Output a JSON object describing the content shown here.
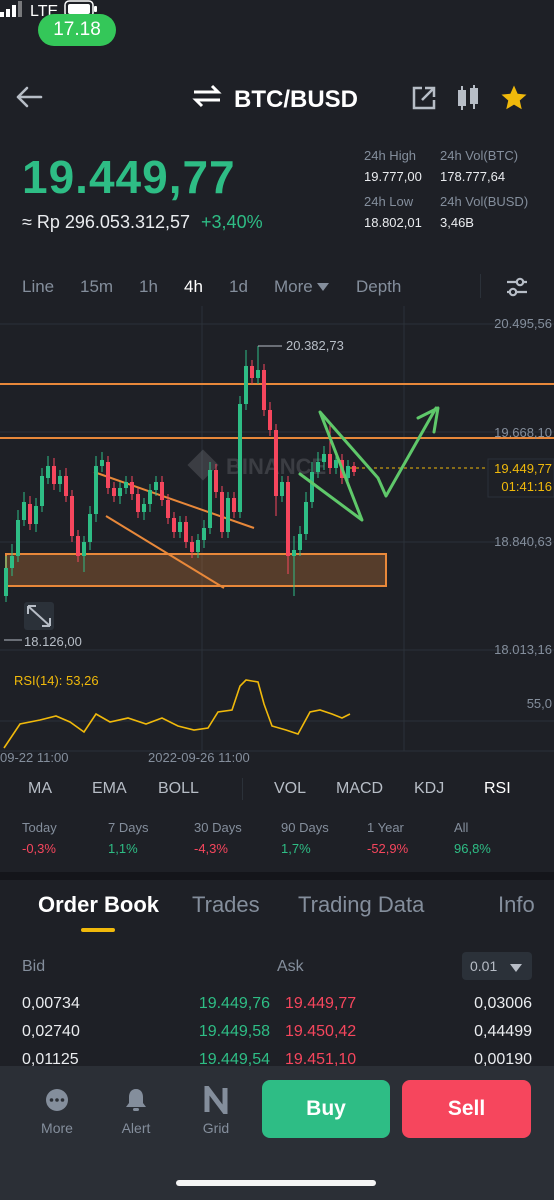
{
  "status_bar": {
    "time": "17.18",
    "network": "LTE"
  },
  "header": {
    "pair": "BTC/BUSD"
  },
  "price": {
    "last": "19.449,77",
    "idr": "≈ Rp 296.053.312,57",
    "change": "+3,40%"
  },
  "stats": {
    "high_label": "24h High",
    "high": "19.777,00",
    "vol_btc_label": "24h Vol(BTC)",
    "vol_btc": "178.777,64",
    "low_label": "24h Low",
    "low": "18.802,01",
    "vol_busd_label": "24h Vol(BUSD)",
    "vol_busd": "3,46B"
  },
  "timeframes": [
    "Line",
    "15m",
    "1h",
    "4h",
    "1d",
    "More",
    "Depth"
  ],
  "active_timeframe": "4h",
  "chart": {
    "watermark": "BINANCE",
    "y_axis_labels": [
      "20.495,56",
      "19.668,10",
      "18.840,63",
      "18.013,16"
    ],
    "current_price_tag": "19.449,77",
    "countdown_tag": "01:41:16",
    "high_marker": "20.382,73",
    "low_marker": "18.126,00",
    "x_labels": [
      "09-22 11:00",
      "2022-09-26 11:00"
    ],
    "rsi_label": "RSI(14): 53,26",
    "rsi_axis": "55,0",
    "candle_up_color": "#2ebd85",
    "candle_down_color": "#f6465d",
    "annotation_color": "#e8883a",
    "drawing_color": "#5fc86a"
  },
  "indicators": [
    "MA",
    "EMA",
    "BOLL",
    "VOL",
    "MACD",
    "KDJ",
    "RSI"
  ],
  "active_indicator": "RSI",
  "performance": [
    {
      "label": "Today",
      "value": "-0,3%",
      "dir": "down"
    },
    {
      "label": "7 Days",
      "value": "1,1%",
      "dir": "up"
    },
    {
      "label": "30 Days",
      "value": "-4,3%",
      "dir": "down"
    },
    {
      "label": "90 Days",
      "value": "1,7%",
      "dir": "up"
    },
    {
      "label": "1 Year",
      "value": "-52,9%",
      "dir": "down"
    },
    {
      "label": "All",
      "value": "96,8%",
      "dir": "up"
    }
  ],
  "orderbook_tabs": [
    "Order Book",
    "Trades",
    "Trading Data",
    "Info"
  ],
  "orderbook": {
    "bid_label": "Bid",
    "ask_label": "Ask",
    "step": "0.01",
    "rows": [
      {
        "bid_qty": "0,00734",
        "bid_price": "19.449,76",
        "ask_price": "19.449,77",
        "ask_qty": "0,03006"
      },
      {
        "bid_qty": "0,02740",
        "bid_price": "19.449,58",
        "ask_price": "19.450,42",
        "ask_qty": "0,44499"
      },
      {
        "bid_qty": "0,01125",
        "bid_price": "19.449,54",
        "ask_price": "19.451,10",
        "ask_qty": "0,00190"
      }
    ]
  },
  "bottom_nav": {
    "more": "More",
    "alert": "Alert",
    "grid": "Grid",
    "buy": "Buy",
    "sell": "Sell"
  }
}
